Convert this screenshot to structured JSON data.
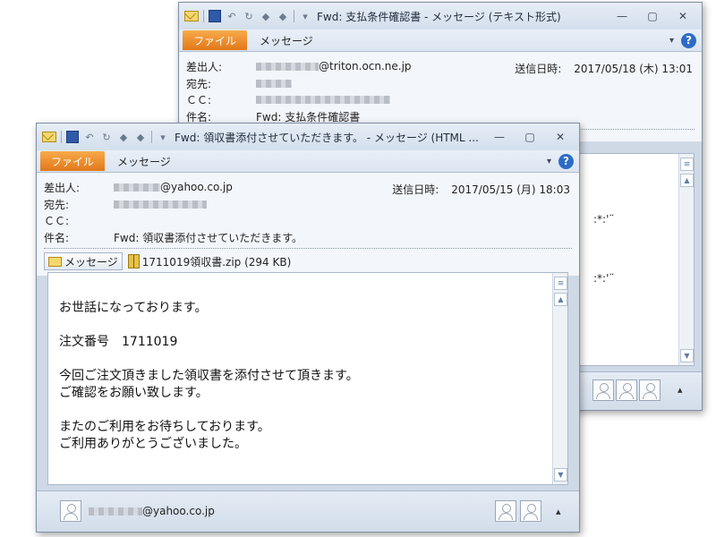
{
  "back_window": {
    "title": "Fwd: 支払条件確認書 - メッセージ (テキスト形式)",
    "ribbon": {
      "file_tab": "ファイル",
      "message_tab": "メッセージ"
    },
    "header": {
      "from_label": "差出人:",
      "from_value": "@triton.ocn.ne.jp",
      "to_label": "宛先:",
      "cc_label": "ＣＣ:",
      "subject_label": "件名:",
      "subject_value": "Fwd: 支払条件確認書",
      "sent_label": "送信日時:",
      "sent_value": "2017/05/18 (木) 13:01"
    },
    "body_fragments": [
      ":*:'¨",
      ":*:'¨"
    ]
  },
  "front_window": {
    "title": "Fwd: 領収書添付させていただきます。 - メッセージ (HTML ...",
    "ribbon": {
      "file_tab": "ファイル",
      "message_tab": "メッセージ"
    },
    "header": {
      "from_label": "差出人:",
      "from_value": "@yahoo.co.jp",
      "to_label": "宛先:",
      "cc_label": "ＣＣ:",
      "subject_label": "件名:",
      "subject_value": "Fwd: 領収書添付させていただきます。",
      "sent_label": "送信日時:",
      "sent_value": "2017/05/15 (月) 18:03"
    },
    "attachments": {
      "message_button": "メッセージ",
      "file_name": "1711019領収書.zip (294 KB)"
    },
    "body_lines": [
      "お世話になっております。",
      "",
      "注文番号　1711019",
      "",
      "今回ご注文頂きました領収書を添付させて頂きます。",
      "ご確認をお願い致します。",
      "",
      "またのご利用をお待ちしております。",
      "ご利用ありがとうございました。"
    ],
    "footer_sender": "@yahoo.co.jp"
  },
  "icons": {
    "minimize": "—",
    "maximize": "▢",
    "close": "✕",
    "help": "?",
    "expand": "▾",
    "collapse": "▴",
    "scroll_up": "▲",
    "scroll_down": "▼",
    "undo": "↶",
    "redo": "↻",
    "up_arrow": "◆",
    "down_arrow": "◆",
    "customize": "▾"
  }
}
